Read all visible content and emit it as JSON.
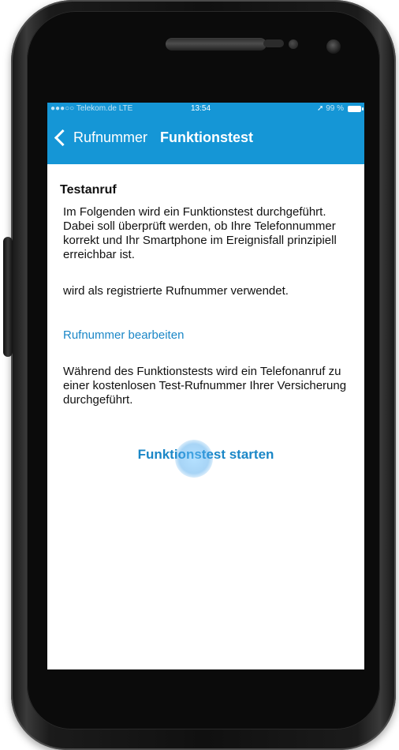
{
  "status_bar": {
    "carrier": "Telekom.de",
    "network": "LTE",
    "time": "13:54",
    "battery": "99 %"
  },
  "nav": {
    "back_label": "Rufnummer",
    "title": "Funktionstest"
  },
  "content": {
    "section_title": "Testanruf",
    "intro": "Im Folgenden wird ein Funktionstest durchgeführt. Dabei soll überprüft werden, ob Ihre Telefonnummer korrekt  und Ihr Smartphone im Ereignisfall prinzipiell erreichbar ist.",
    "registered_text": "wird als registrierte Rufnummer verwendet.",
    "edit_link": "Rufnummer bearbeiten",
    "during_text": "Während des Funktionstests wird ein Telefonanruf zu einer kostenlosen Test-Rufnummer Ihrer Versicherung durchgeführt.",
    "start_button": "Funktionstest starten"
  },
  "colors": {
    "accent": "#1596d6",
    "link": "#1b87c7"
  },
  "icons": {
    "back": "chevron-left-icon",
    "signal": "signal-dots-icon",
    "location": "location-arrow-icon",
    "battery": "battery-icon"
  }
}
